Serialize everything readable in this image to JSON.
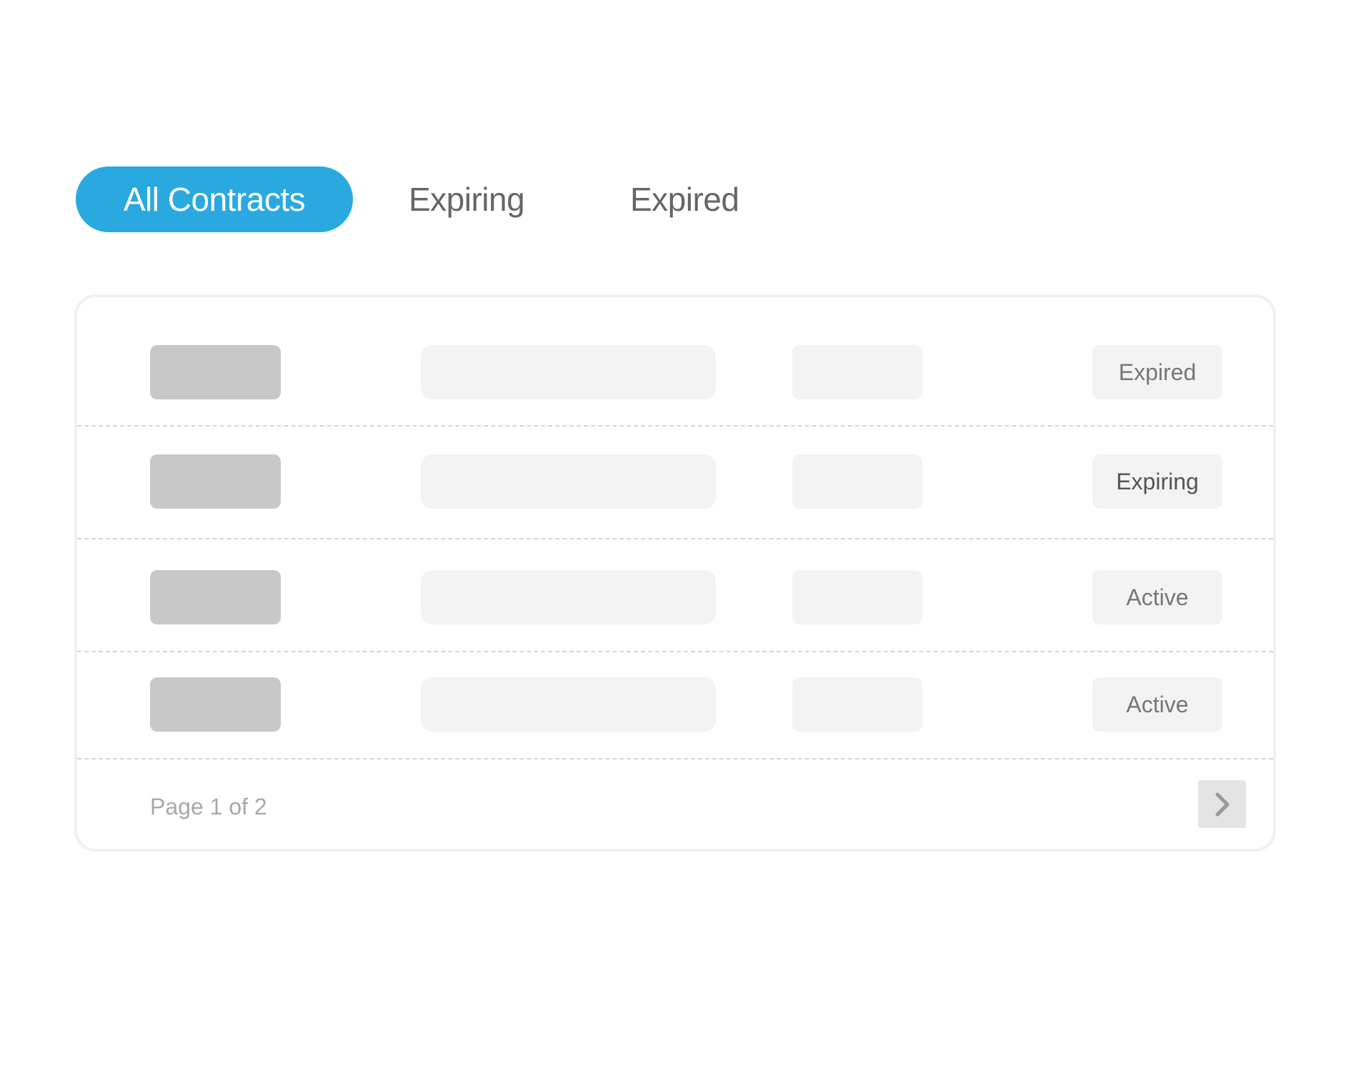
{
  "tabs": [
    {
      "label": "All Contracts",
      "active": true
    },
    {
      "label": "Expiring",
      "active": false
    },
    {
      "label": "Expired",
      "active": false
    }
  ],
  "colors": {
    "accent": "#2aa9e0",
    "placeholder_dark": "#c8c8c8",
    "placeholder_light": "#f3f3f3"
  },
  "table": {
    "rows": [
      {
        "status": "Expired"
      },
      {
        "status": "Expiring"
      },
      {
        "status": "Active"
      },
      {
        "status": "Active"
      }
    ]
  },
  "pagination": {
    "label": "Page 1 of 2",
    "current_page": 1,
    "total_pages": 2,
    "next_icon": "chevron-right-icon"
  }
}
